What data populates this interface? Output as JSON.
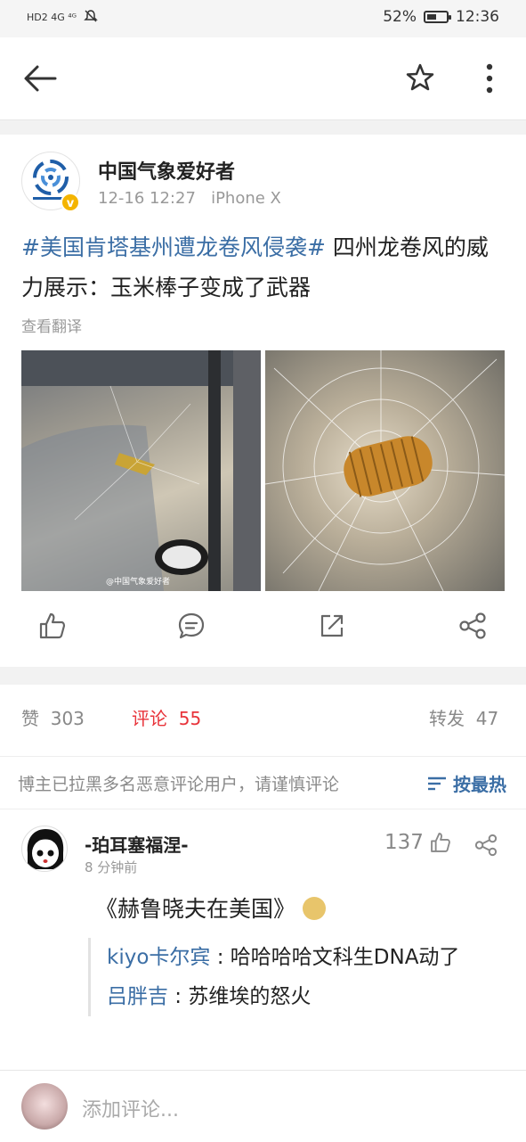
{
  "status_bar": {
    "network": "HD2 4G ⁴ᴳ",
    "battery_percent_text": "52%",
    "battery_level": 0.52,
    "time": "12:36"
  },
  "header": {
    "back_icon": "arrow-left-icon",
    "favorite_icon": "star-outline-icon",
    "more_icon": "vertical-dots-icon"
  },
  "post": {
    "author": "中国气象爱好者",
    "verified_badge": "v",
    "timestamp": "12-16 12:27",
    "device": "iPhone X",
    "hashtag": "#美国肯塔基州遭龙卷风侵袭#",
    "text": " 四州龙卷风的威力展示：玉米棒子变成了武器",
    "translate_label": "查看翻译",
    "image1_watermark": "@中国气象爱好者"
  },
  "actions": {
    "like_icon": "thumbs-up-icon",
    "comment_icon": "comment-icon",
    "repost_icon": "share-box-icon",
    "share_icon": "share-nodes-icon"
  },
  "tabs": {
    "likes_label": "赞",
    "likes_count": "303",
    "comments_label": "评论",
    "comments_count": "55",
    "reposts_label": "转发",
    "reposts_count": "47"
  },
  "notice": {
    "text": "博主已拉黑多名恶意评论用户，请谨慎评论",
    "sort_label": "按最热"
  },
  "comment": {
    "username": "-珀耳塞福涅-",
    "time": "8 分钟前",
    "likes": "137",
    "text": "《赫鲁晓夫在美国》",
    "replies": [
      {
        "name": "kiyo卡尔宾",
        "text": "哈哈哈哈文科生DNA动了"
      },
      {
        "name": "吕胖吉",
        "text": "苏维埃的怒火"
      }
    ]
  },
  "bottom_bar": {
    "placeholder": "添加评论..."
  },
  "colors": {
    "link_blue": "#3b6ea5",
    "active_red": "#e8333a"
  }
}
